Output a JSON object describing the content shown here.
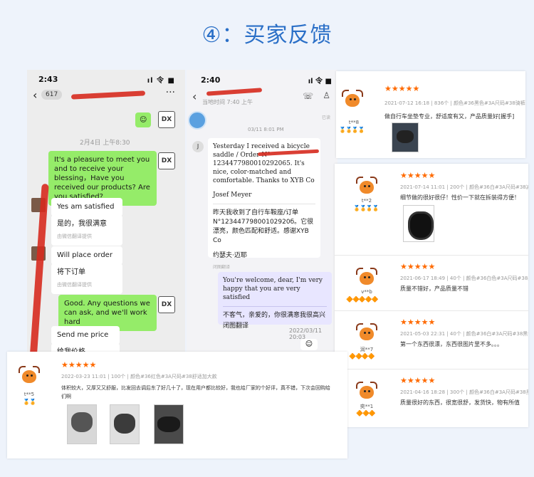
{
  "title": "④：买家反馈",
  "phone1": {
    "time": "2:43",
    "signal": "ıl 令 ■",
    "back_count": "617",
    "more": "···",
    "timestamp": "2月4日 上午8:30",
    "avatar_label": "DX",
    "messages": {
      "seller1": "It's a pleasure to meet you and to receive your blessing，Have you received our products? Are you satisfied?",
      "buyer1_en": "Yes am satisfied",
      "buyer1_zh": "是的，我很满意",
      "buyer1_note": "由微信翻译提供",
      "buyer2_en": "Will place order",
      "buyer2_zh": "将下订单",
      "buyer2_note": "由微信翻译提供",
      "seller2": "Good. Any questions we can ask, and we'll work hard",
      "buyer3_en": "Send me price",
      "buyer3_zh": "给我价格"
    }
  },
  "phone2": {
    "time": "2:40",
    "signal": "ıl 令 ■",
    "subtitle": "当地时间 7:40 上午",
    "date1": "03/11 8:01 PM",
    "avatar_letter": "J",
    "letter_en": "Yesterday I received a bicycle saddle / Order N° 1234477980010292065. It's nice, color-matched and comfortable. Thanks to XYB Co",
    "signature_en": "Josef Meyer",
    "letter_zh": "昨天我收到了自行车鞍座/订单N°12344779800102920б。它很漂亮，颜色匹配和舒适。感谢XYB Co",
    "signature_zh": "约瑟夫·迈耶",
    "translate_note": "闭图翻译",
    "read": "已读",
    "reply_en": "You're welcome, dear, I'm very happy that you are very satisfied",
    "reply_zh": "不客气，亲爱的，你很满意我很高兴",
    "reply_note": "闭图翻译",
    "reply_time": "2022/03/11 20:03"
  },
  "reviews": [
    {
      "user": "t**8",
      "date": "2021-07-12 16:18",
      "count": "836个",
      "spec": "颜色#36黑色#3A尺码#38骑裤#39",
      "text": "做自行车坐垫专业，舒适度有又，产品质量好[握手]",
      "stars": "★★★★★",
      "badge": "🏅🏅🏅🏅"
    },
    {
      "user": "t**2",
      "date": "2021-07-14 11:01",
      "count": "200个",
      "spec": "颜色#36白#3A尺码#38减震",
      "text": "细节做的很好很仔！性价一下就在拆装得方便！",
      "stars": "★★★★★",
      "badge": "🏅🏅🏅🏅"
    },
    {
      "user": "v**b",
      "date": "2021-06-17 18:49",
      "count": "40个",
      "spec": "颜色#36白色#3A尺码#38黑色",
      "text": "质量不错好，产品质量不错",
      "stars": "★★★★★",
      "badge": "🔶🔶🔶🔶🔶"
    },
    {
      "user": "润**7",
      "date": "2021-05-03 22:31",
      "count": "40个",
      "spec": "颜色#36白#3A尺码#38黑色",
      "text": "第一个东西很漂，东西很图片里不多。。。",
      "stars": "★★★★★",
      "badge": "🔶🔶🔶🔶"
    },
    {
      "user": "奕**1",
      "date": "2021-04-16 18:28",
      "count": "300个",
      "spec": "颜色#36白#3A尺码#38黑色",
      "text": "质量很好的东西，很宽很舒，发货快，物有所值",
      "stars": "★★★★★",
      "badge": "🔶🔶🔶"
    }
  ],
  "bottom_review": {
    "user": "t**5",
    "date": "2022-03-23 11:01",
    "count": "100个",
    "spec": "颜色#36红色#3A尺码#38舒适加大款",
    "text": "体积较大，又厚又又舒服，比发回去调后东了好几十了，现在用户都比较好，我也给厂家的个好评，真不错，下次会回购给",
    "text2": "们啊",
    "stars": "★★★★★",
    "badge": "🏅🏅"
  }
}
